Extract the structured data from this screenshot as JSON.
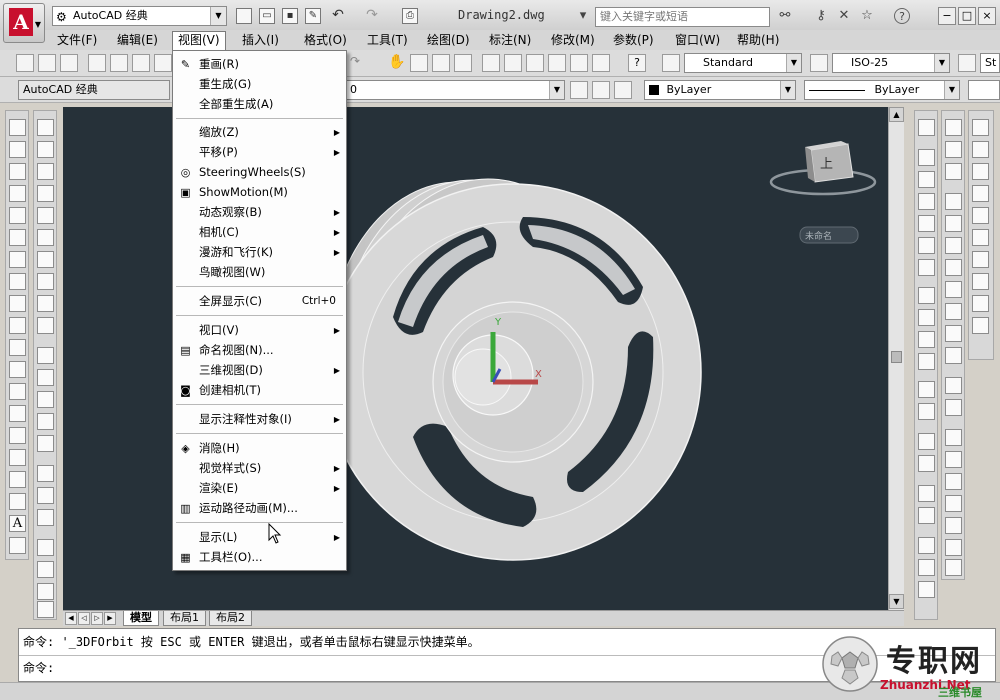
{
  "titlebar": {
    "workspace": "AutoCAD 经典",
    "document_title": "Drawing2.dwg",
    "search_placeholder": "键入关键字或短语"
  },
  "menubar": {
    "items": [
      "文件(F)",
      "编辑(E)",
      "视图(V)",
      "插入(I)",
      "格式(O)",
      "工具(T)",
      "绘图(D)",
      "标注(N)",
      "修改(M)",
      "参数(P)",
      "窗口(W)",
      "帮助(H)"
    ],
    "active_index": 2
  },
  "toolbar2": {
    "text_style": "Standard",
    "dim_style": "ISO-25",
    "table_style": "St"
  },
  "toolbar3": {
    "workspace": "AutoCAD 经典",
    "layer": "0",
    "color": "ByLayer",
    "linetype": "ByLayer"
  },
  "view_menu": {
    "items": [
      {
        "label": "重画(R)",
        "icon": "pencil-icon"
      },
      {
        "label": "重生成(G)"
      },
      {
        "label": "全部重生成(A)"
      },
      {
        "label": "缩放(Z)",
        "submenu": true
      },
      {
        "label": "平移(P)",
        "submenu": true
      },
      {
        "label": "SteeringWheels(S)",
        "icon": "steering-wheel-icon"
      },
      {
        "label": "ShowMotion(M)",
        "icon": "showmotion-icon"
      },
      {
        "label": "动态观察(B)",
        "submenu": true
      },
      {
        "label": "相机(C)",
        "submenu": true
      },
      {
        "label": "漫游和飞行(K)",
        "submenu": true
      },
      {
        "label": "鸟瞰视图(W)"
      },
      {
        "label": "全屏显示(C)",
        "accel": "Ctrl+0"
      },
      {
        "label": "视口(V)",
        "submenu": true
      },
      {
        "label": "命名视图(N)...",
        "icon": "named-view-icon"
      },
      {
        "label": "三维视图(D)",
        "submenu": true
      },
      {
        "label": "创建相机(T)",
        "icon": "camera-icon"
      },
      {
        "label": "显示注释性对象(I)",
        "submenu": true
      },
      {
        "label": "消隐(H)",
        "icon": "hide-icon"
      },
      {
        "label": "视觉样式(S)",
        "submenu": true
      },
      {
        "label": "渲染(E)",
        "submenu": true
      },
      {
        "label": "运动路径动画(M)...",
        "icon": "motion-path-icon"
      },
      {
        "label": "显示(L)",
        "submenu": true
      },
      {
        "label": "工具栏(O)...",
        "icon": "toolbar-icon"
      }
    ]
  },
  "viewcube": {
    "face_label": "上",
    "named_view": "未命名"
  },
  "layout_tabs": [
    "模型",
    "布局1",
    "布局2"
  ],
  "command_line": {
    "history": "命令: '_3DFOrbit 按 ESC 或 ENTER 键退出，或者单击鼠标右键显示快捷菜单。",
    "prompt": "命令:"
  },
  "watermark": {
    "title": "专职网",
    "subtitle": "三维书屋",
    "url": "Zhuanzhi.Net"
  },
  "colors": {
    "viewport_bg": "#263139",
    "model_fill": "#d9d9d9",
    "menu_bg": "#fdfdfd",
    "logo_red": "#c8102e"
  }
}
